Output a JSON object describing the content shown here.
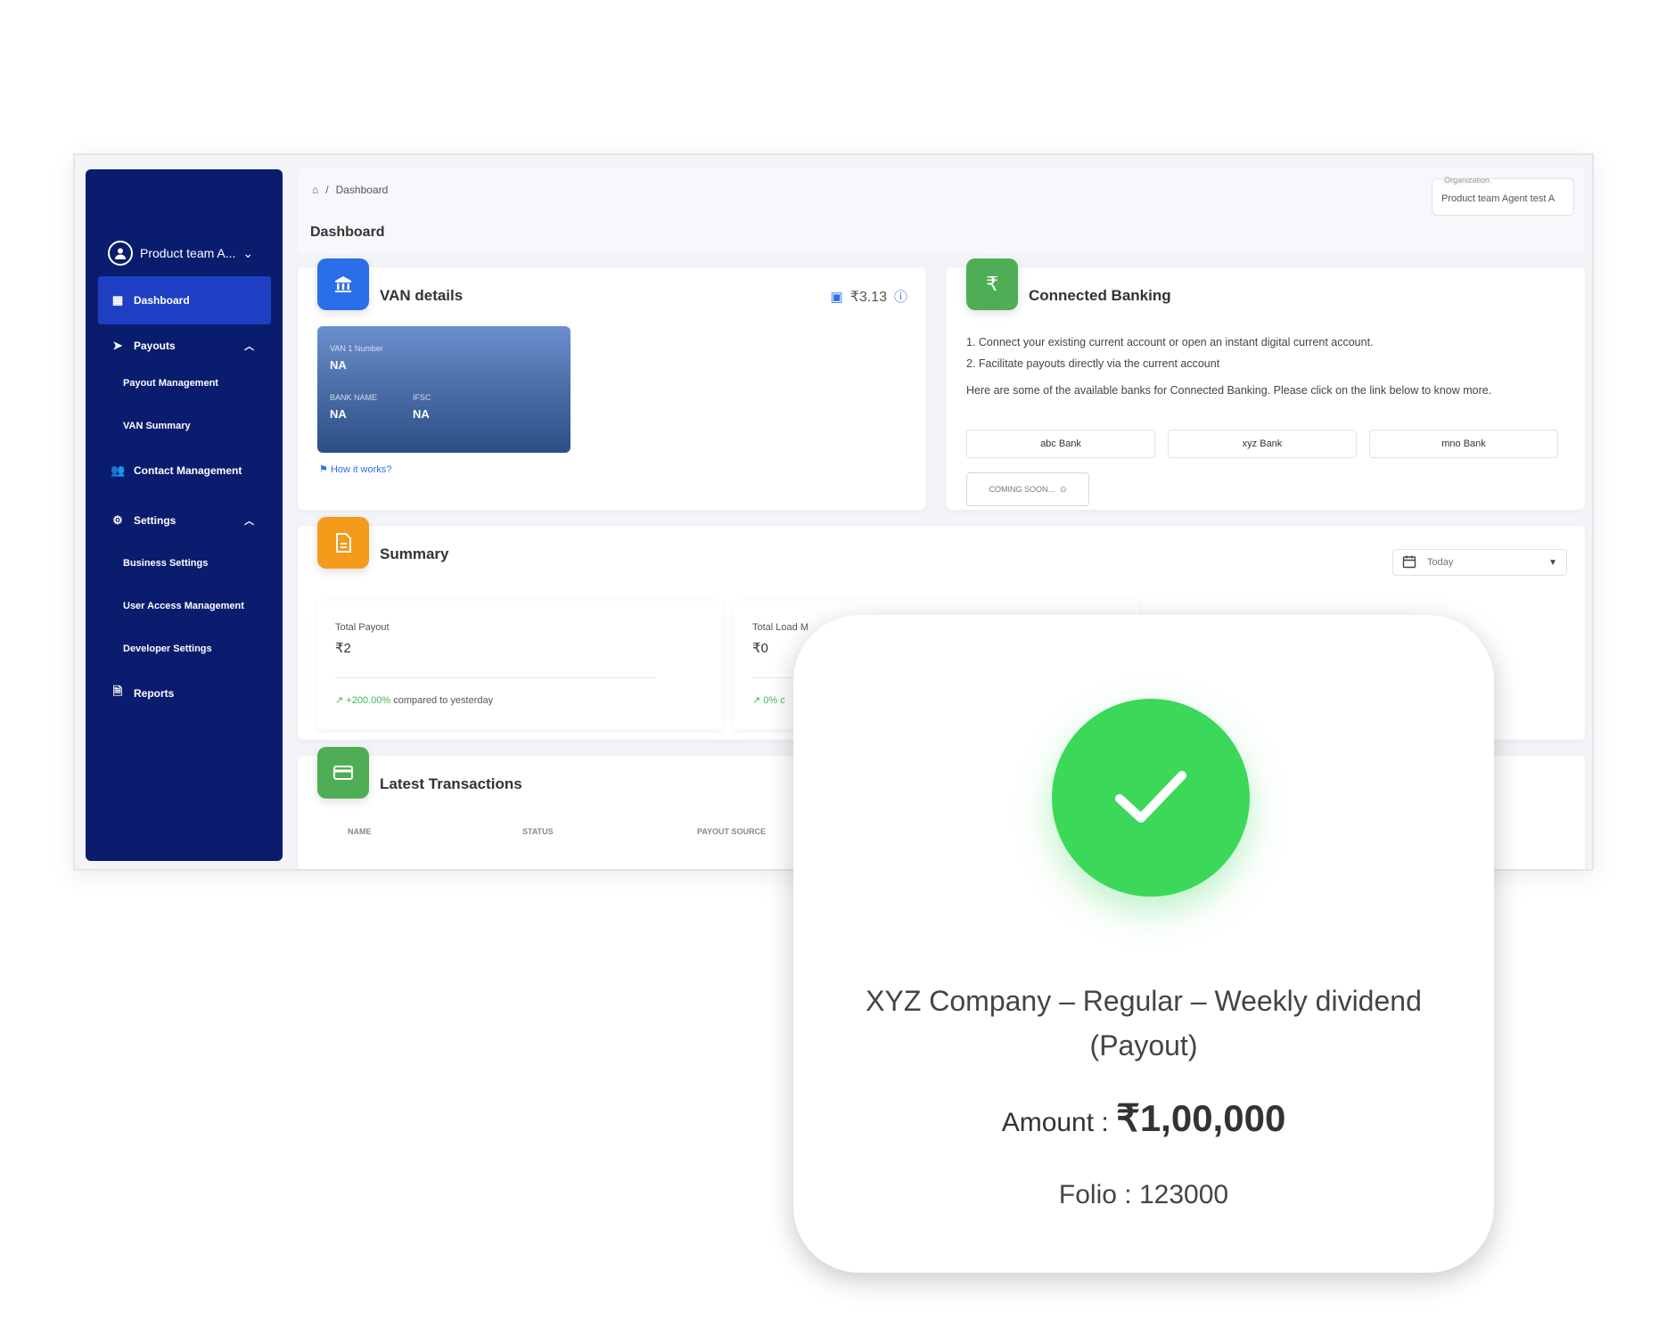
{
  "sidebar": {
    "user_name": "Product team A...",
    "items": [
      {
        "label": "Dashboard"
      },
      {
        "label": "Payouts"
      },
      {
        "label": "Payout Management"
      },
      {
        "label": "VAN Summary"
      },
      {
        "label": "Contact Management"
      },
      {
        "label": "Settings"
      },
      {
        "label": "Business Settings"
      },
      {
        "label": "User Access Management"
      },
      {
        "label": "Developer Settings"
      },
      {
        "label": "Reports"
      }
    ]
  },
  "header": {
    "breadcrumb_sep": "/",
    "breadcrumb": "Dashboard",
    "title": "Dashboard",
    "org_label": "Organization",
    "org_value": "Product team Agent test A"
  },
  "van": {
    "title": "VAN details",
    "balance": "₹3.13",
    "number_label": "VAN 1 Number",
    "number_value": "NA",
    "bank_label": "BANK NAME",
    "bank_value": "NA",
    "ifsc_label": "IFSC",
    "ifsc_value": "NA",
    "how_link": "How it works?"
  },
  "banking": {
    "title": "Connected Banking",
    "line1": "1. Connect your existing current account or open an instant digital current account.",
    "line2": "2. Facilitate payouts directly via the current account",
    "line3": "Here are some of the available banks for Connected Banking. Please click on the link below to know more.",
    "banks": [
      "abc Bank",
      "xyz Bank",
      "mno Bank"
    ],
    "coming_soon": "COMING SOON..."
  },
  "summary": {
    "title": "Summary",
    "date_filter": "Today",
    "total_payout_label": "Total Payout",
    "total_payout_value": "₹2",
    "total_payout_trend": "+200.00%",
    "total_payout_trend_text": "compared to yesterday",
    "total_load_label": "Total Load M",
    "total_load_value": "₹0",
    "total_load_trend": "0% c"
  },
  "transactions": {
    "title": "Latest Transactions",
    "columns": [
      "NAME",
      "STATUS",
      "PAYOUT SOURCE"
    ]
  },
  "popup": {
    "title": "XYZ Company  – Regular – Weekly dividend (Payout)",
    "amount_label": "Amount : ",
    "amount_value": "₹1,00,000",
    "folio_label": "Folio :  ",
    "folio_value": "123000"
  },
  "colors": {
    "sidebar": "#0a1c6e",
    "active": "#1e3fc4",
    "success": "#3bd85a",
    "van_badge": "#2a6fe8",
    "bank_badge": "#4fae55",
    "summary_badge": "#f59a1b"
  },
  "icons": {
    "home": "home-icon",
    "bank": "bank-icon",
    "rupee": "rupee-icon",
    "document": "document-icon",
    "card": "credit-card-icon",
    "calendar": "calendar-icon",
    "check": "check-icon"
  }
}
